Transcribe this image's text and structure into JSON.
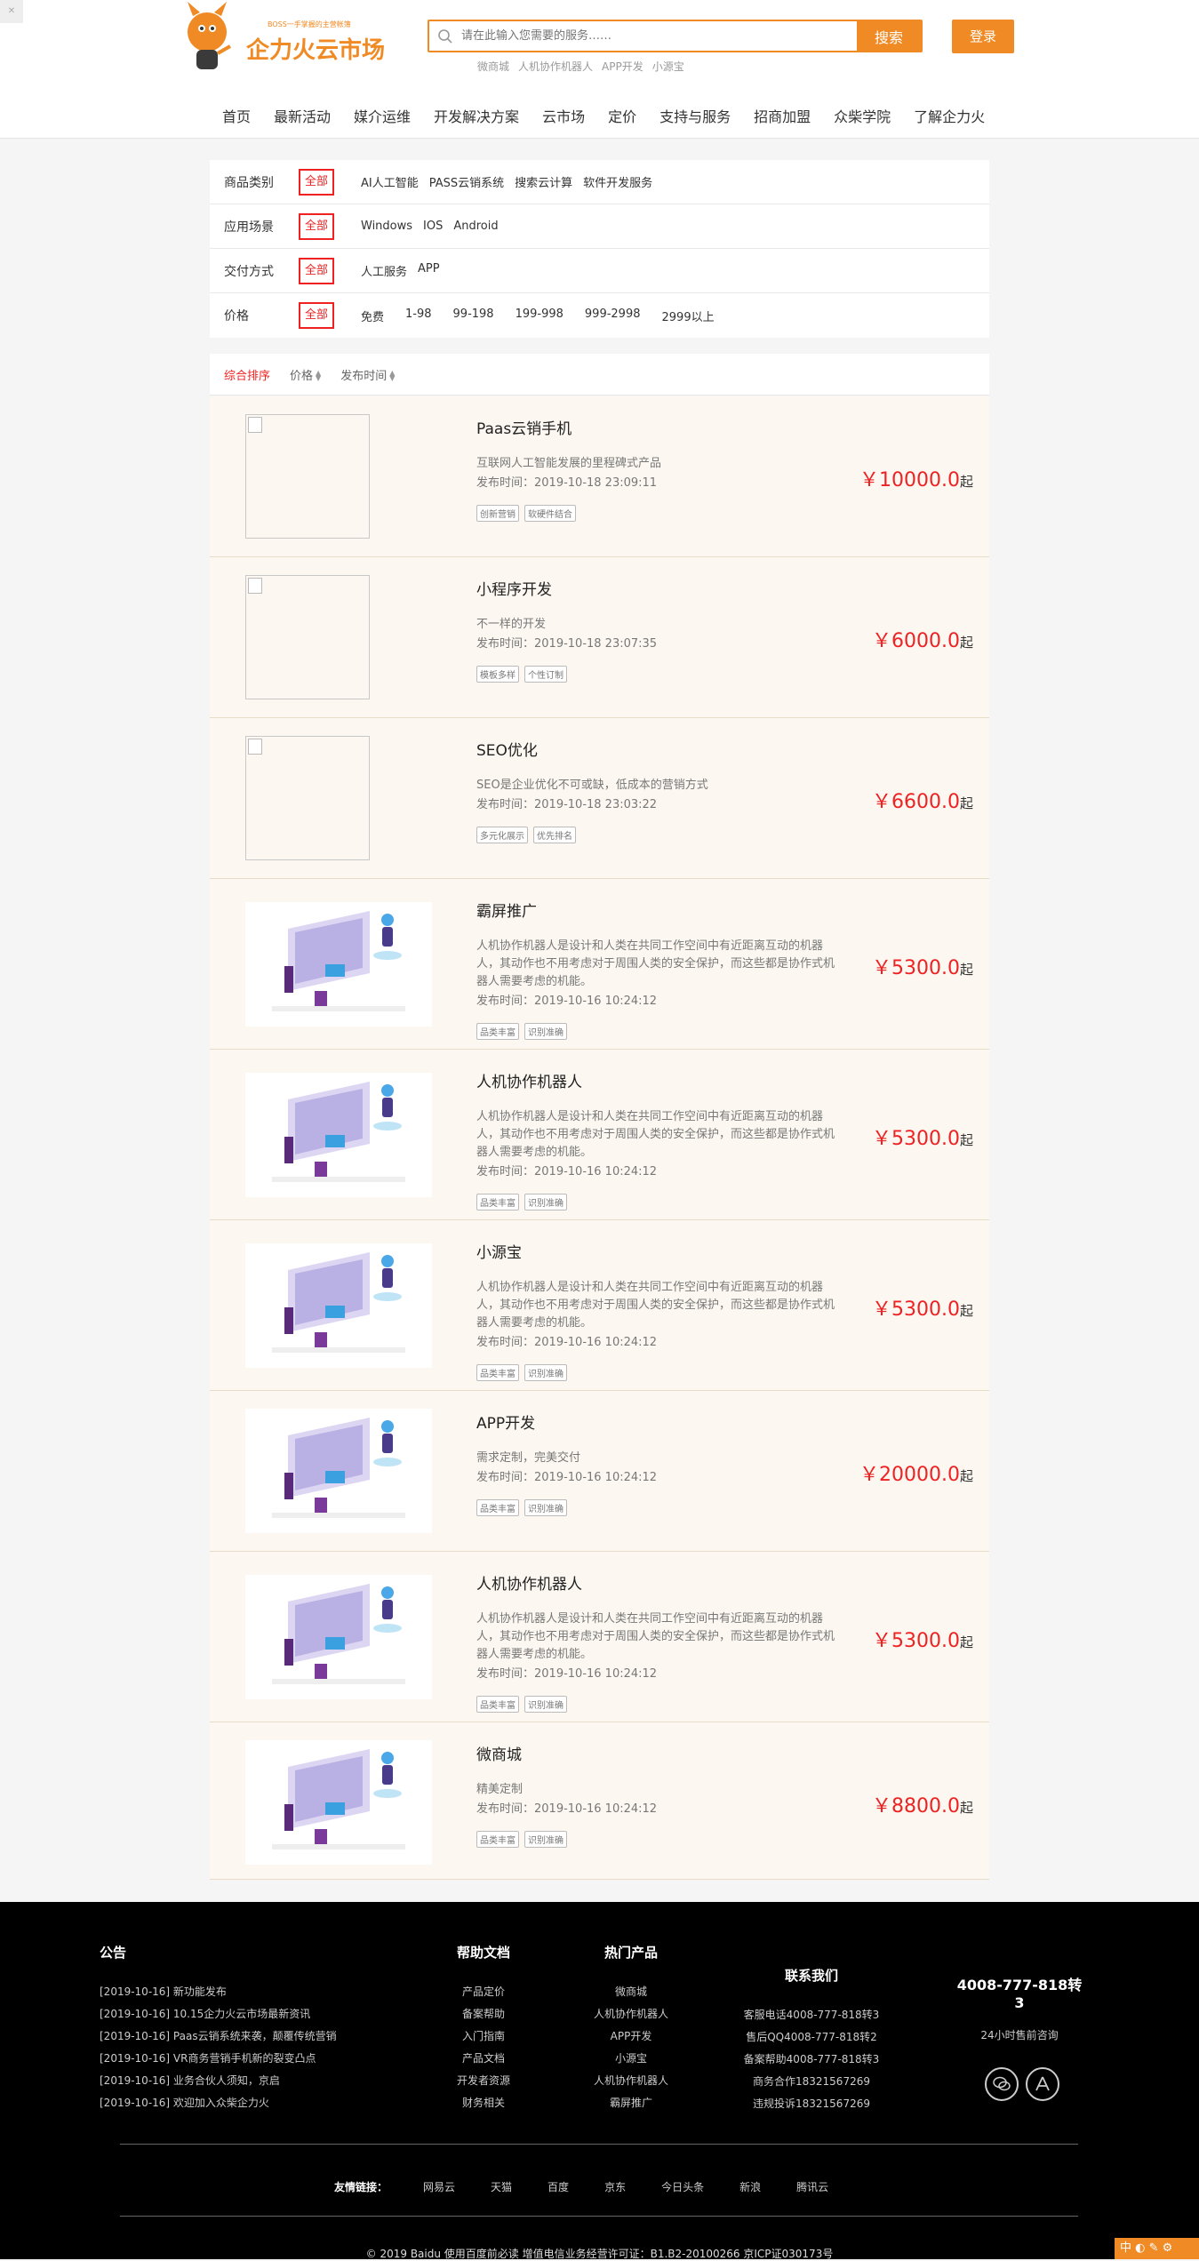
{
  "header": {
    "corner_label": "✕",
    "logo_tagline": "BOSS一手掌握的主营帐簿",
    "logo_text": "企力火云市场",
    "search_placeholder": "请在此输入您需要的服务……",
    "search_button": "搜索",
    "login_button": "登录",
    "hot_words": [
      "微商城",
      "人机协作机器人",
      "APP开发",
      "小源宝"
    ]
  },
  "nav": [
    "首页",
    "最新活动",
    "媒介运维",
    "开发解决方案",
    "云市场",
    "定价",
    "支持与服务",
    "招商加盟",
    "众柴学院",
    "了解企力火"
  ],
  "filters": [
    {
      "label": "商品类别",
      "all": "全部",
      "options": [
        "AI人工智能",
        "PASS云销系统",
        "搜索云计算",
        "软件开发服务"
      ]
    },
    {
      "label": "应用场景",
      "all": "全部",
      "options": [
        "Windows",
        "IOS",
        "Android"
      ]
    },
    {
      "label": "交付方式",
      "all": "全部",
      "options": [
        "人工服务",
        "APP"
      ]
    },
    {
      "label": "价格",
      "all": "全部",
      "options": [
        "免费",
        "1-98",
        "99-198",
        "199-998",
        "999-2998",
        "2999以上"
      ]
    }
  ],
  "sort": {
    "comprehensive": "综合排序",
    "price": "价格",
    "publish_time": "发布时间"
  },
  "products": [
    {
      "title": "Paas云销手机",
      "desc": "互联网人工智能发展的里程碑式产品",
      "date": "发布时间：2019-10-18 23:09:11",
      "tags": [
        "创新营销",
        "软硬件结合"
      ],
      "price": "￥10000.0",
      "unit": "起",
      "image": "broken"
    },
    {
      "title": "小程序开发",
      "desc": "不一样的开发",
      "date": "发布时间：2019-10-18 23:07:35",
      "tags": [
        "模板多样",
        "个性订制"
      ],
      "price": "￥6000.0",
      "unit": "起",
      "image": "broken"
    },
    {
      "title": "SEO优化",
      "desc": "SEO是企业优化不可或缺，低成本的营销方式",
      "date": "发布时间：2019-10-18 23:03:22",
      "tags": [
        "多元化展示",
        "优先排名"
      ],
      "price": "￥6600.0",
      "unit": "起",
      "image": "broken"
    },
    {
      "title": "霸屏推广",
      "desc": "人机协作机器人是设计和人类在共同工作空间中有近距离互动的机器人，其动作也不用考虑对于周围人类的安全保护，而这些都是协作式机器人需要考虑的机能。",
      "date": "发布时间：2019-10-16 10:24:12",
      "tags": [
        "品类丰富",
        "识别准确"
      ],
      "price": "￥5300.0",
      "unit": "起",
      "image": "illustration"
    },
    {
      "title": "人机协作机器人",
      "desc": "人机协作机器人是设计和人类在共同工作空间中有近距离互动的机器人，其动作也不用考虑对于周围人类的安全保护，而这些都是协作式机器人需要考虑的机能。",
      "date": "发布时间：2019-10-16 10:24:12",
      "tags": [
        "品类丰富",
        "识别准确"
      ],
      "price": "￥5300.0",
      "unit": "起",
      "image": "illustration"
    },
    {
      "title": "小源宝",
      "desc": "人机协作机器人是设计和人类在共同工作空间中有近距离互动的机器人，其动作也不用考虑对于周围人类的安全保护，而这些都是协作式机器人需要考虑的机能。",
      "date": "发布时间：2019-10-16 10:24:12",
      "tags": [
        "品类丰富",
        "识别准确"
      ],
      "price": "￥5300.0",
      "unit": "起",
      "image": "illustration"
    },
    {
      "title": "APP开发",
      "desc": "需求定制，完美交付",
      "date": "发布时间：2019-10-16 10:24:12",
      "tags": [
        "品类丰富",
        "识别准确"
      ],
      "price": "￥20000.0",
      "unit": "起",
      "image": "illustration"
    },
    {
      "title": "人机协作机器人",
      "desc": "人机协作机器人是设计和人类在共同工作空间中有近距离互动的机器人，其动作也不用考虑对于周围人类的安全保护，而这些都是协作式机器人需要考虑的机能。",
      "date": "发布时间：2019-10-16 10:24:12",
      "tags": [
        "品类丰富",
        "识别准确"
      ],
      "price": "￥5300.0",
      "unit": "起",
      "image": "illustration"
    },
    {
      "title": "微商城",
      "desc": "精美定制",
      "date": "发布时间：2019-10-16 10:24:12",
      "tags": [
        "品类丰富",
        "识别准确"
      ],
      "price": "￥8800.0",
      "unit": "起",
      "image": "illustration"
    }
  ],
  "footer": {
    "notices_title": "公告",
    "notices": [
      "[2019-10-16] 新功能发布",
      "[2019-10-16] 10.15企力火云市场最新资讯",
      "[2019-10-16] Paas云销系统来袭，颠覆传统营销",
      "[2019-10-16] VR商务营销手机新的裂变凸点",
      "[2019-10-16] 业务合伙人须知，京启",
      "[2019-10-16] 欢迎加入众柴企力火"
    ],
    "help_title": "帮助文档",
    "help": [
      "产品定价",
      "备案帮助",
      "入门指南",
      "产品文档",
      "开发者资源",
      "财务相关"
    ],
    "hot_title": "热门产品",
    "hot": [
      "微商城",
      "人机协作机器人",
      "APP开发",
      "小源宝",
      "人机协作机器人",
      "霸屏推广"
    ],
    "contact_title": "联系我们",
    "contact": [
      "客服电话4008-777-818转3",
      "售后QQ4008-777-818转2",
      "备案帮助4008-777-818转3",
      "商务合作18321567269",
      "违规投诉18321567269"
    ],
    "phone": "4008-777-818转3",
    "phone_sub": "24小时售前咨询",
    "links_label": "友情链接：",
    "links": [
      "网易云",
      "天猫",
      "百度",
      "京东",
      "今日头条",
      "新浪",
      "腾讯云"
    ],
    "copyright": "© 2019 Baidu 使用百度前必读 增值电信业务经营许可证：B1.B2-20100266 京ICP证030173号"
  },
  "ime_bar": "中 ◐ ✎ ⚙",
  "colors": {
    "accent": "#f08a24",
    "price": "#e22222",
    "item_bg": "#fcf8f1",
    "footer_bg": "#000000"
  }
}
